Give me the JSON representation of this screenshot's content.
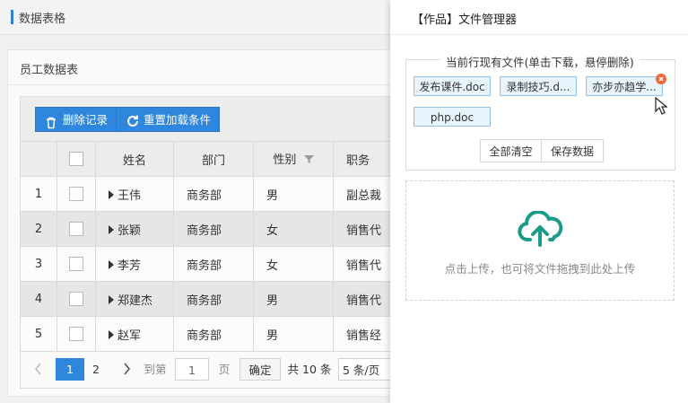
{
  "header": {
    "title": "数据表格"
  },
  "panel": {
    "title": "员工数据表"
  },
  "toolbar": {
    "delete_label": "删除记录",
    "reload_label": "重置加载条件"
  },
  "table": {
    "columns": [
      "姓名",
      "部门",
      "性别",
      "职务"
    ],
    "rows": [
      {
        "num": "1",
        "name": "王伟",
        "dept": "商务部",
        "sex": "男",
        "title": "副总裁"
      },
      {
        "num": "2",
        "name": "张颖",
        "dept": "商务部",
        "sex": "女",
        "title": "销售代"
      },
      {
        "num": "3",
        "name": "李芳",
        "dept": "商务部",
        "sex": "女",
        "title": "销售代"
      },
      {
        "num": "4",
        "name": "郑建杰",
        "dept": "商务部",
        "sex": "男",
        "title": "销售代"
      },
      {
        "num": "5",
        "name": "赵军",
        "dept": "商务部",
        "sex": "男",
        "title": "销售经"
      }
    ]
  },
  "pager": {
    "page1": "1",
    "page2": "2",
    "goto_label": "到第",
    "page_input": "1",
    "page_unit": "页",
    "confirm": "确定",
    "total": "共 10 条",
    "page_size": "5 条/页"
  },
  "drawer": {
    "title": "【作品】文件管理器",
    "legend": "当前行现有文件(单击下载，悬停删除)",
    "files": [
      "发布课件.doc",
      "录制技巧.d...",
      "亦步亦趋学...",
      "php.doc"
    ],
    "clear_all": "全部清空",
    "save": "保存数据",
    "upload_hint": "点击上传，也可将文件拖拽到此处上传"
  },
  "colors": {
    "accent": "#2f86dd",
    "upload_icon": "#1a9c8b",
    "remove_badge": "#f0683a"
  }
}
